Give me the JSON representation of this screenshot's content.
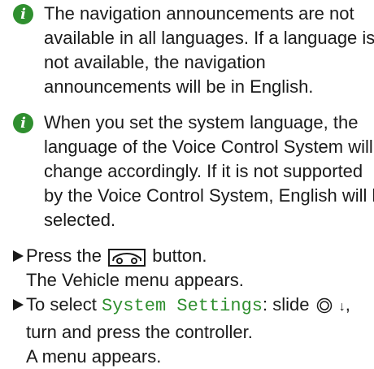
{
  "note1": {
    "icon": "info-icon",
    "lines": [
      "The navigation announcements are not",
      "available in all languages. If a language is",
      "not available, the navigation",
      "announcements will be in English."
    ]
  },
  "note2": {
    "icon": "info-icon",
    "lines": [
      "When you set the system language, the",
      "language of the Voice Control System will",
      "change accordingly. If it is not supported",
      "by the Voice Control System, English will be",
      "selected."
    ]
  },
  "step1": {
    "text_before": "Press the",
    "button_icon": "car-button-icon",
    "text_after": "button.",
    "result": "The Vehicle menu appears."
  },
  "step2": {
    "text_before": "To select",
    "highlight": "System Settings",
    "text_mid": ": slide",
    "controller_icon": "controller-icon",
    "down_arrow": "↓",
    "text_after": ",",
    "line2": "turn and press the controller.",
    "result": "A menu appears."
  },
  "colors": {
    "accent": "#2f8f2f",
    "text": "#1a1a1a"
  }
}
